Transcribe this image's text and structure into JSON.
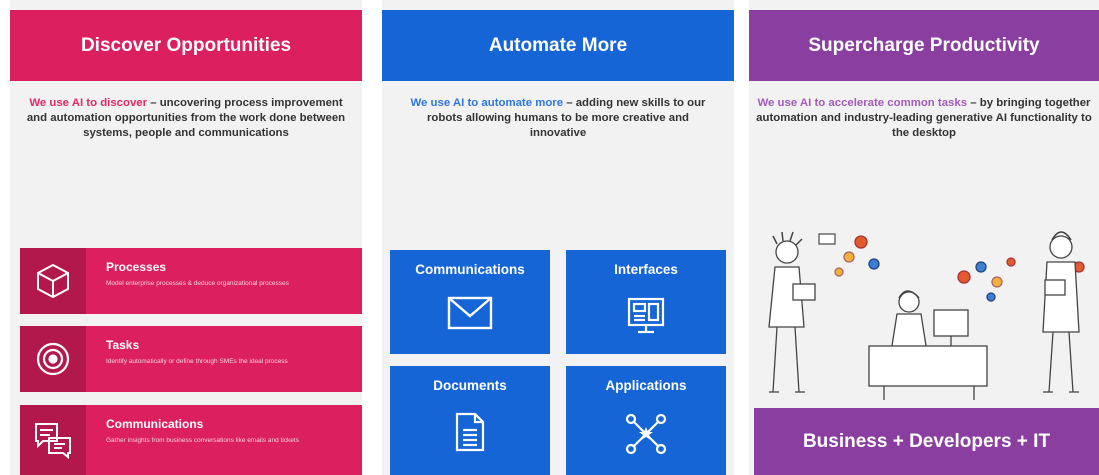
{
  "columns": [
    {
      "title": "Discover Opportunities",
      "highlight": "We use AI to discover",
      "text": " – uncovering process improvement and automation opportunities from the work done between systems, people and communications",
      "accent": "#dc1f5e",
      "items": [
        {
          "title": "Processes",
          "sub": "Model enterprise processes & deduce organizational processes",
          "icon": "cube-icon"
        },
        {
          "title": "Tasks",
          "sub": "Identify automatically or define through SMEs the ideal process",
          "icon": "target-icon"
        },
        {
          "title": "Communications",
          "sub": "Gather insights from business conversations like emails and tickets",
          "icon": "chat-icon"
        }
      ]
    },
    {
      "title": "Automate More",
      "highlight": "We use AI to automate more",
      "text": " – adding new skills to our robots allowing humans to be more creative and innovative",
      "accent": "#1565d6",
      "tiles": [
        {
          "label": "Communications",
          "icon": "envelope-icon"
        },
        {
          "label": "Interfaces",
          "icon": "monitor-icon"
        },
        {
          "label": "Documents",
          "icon": "document-icon"
        },
        {
          "label": "Applications",
          "icon": "network-icon"
        }
      ]
    },
    {
      "title": "Supercharge Productivity",
      "highlight": "We use AI to accelerate common tasks",
      "text": " – by bringing together automation and industry-leading generative AI functionality to the desktop",
      "accent": "#8a3ea0",
      "banner": "Business + Developers + IT"
    }
  ]
}
